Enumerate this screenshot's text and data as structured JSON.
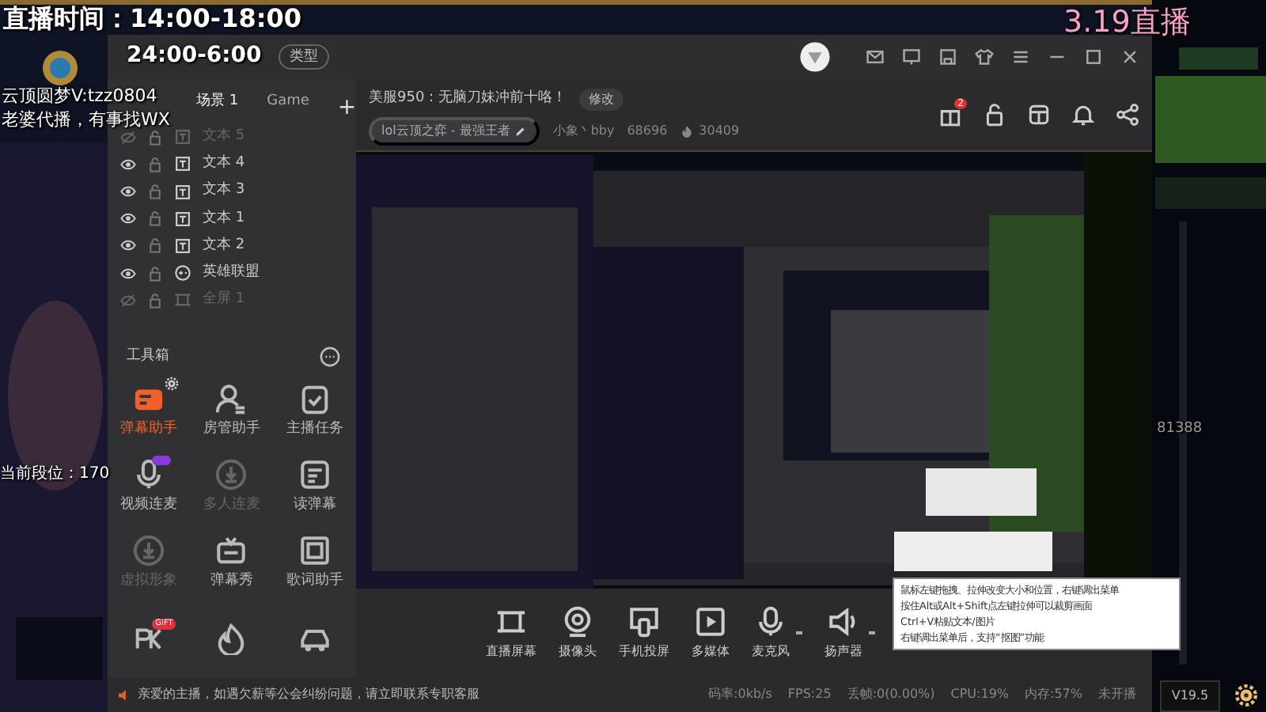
{
  "overlay": {
    "live_time": "直播时间：14:00-18:00",
    "night_time": "24:00-6:00",
    "contact_1": "云顶圆梦V:tzz0804",
    "contact_2": "老婆代播，有事找WX",
    "rank": "当前段位：170",
    "date_live": "3.19直播",
    "side_number": "81388"
  },
  "window": {
    "type_button": "类型",
    "title_icons": [
      {
        "kind": "mail"
      },
      {
        "kind": "monitor"
      },
      {
        "kind": "save"
      },
      {
        "kind": "shirt"
      },
      {
        "kind": "menu"
      },
      {
        "kind": "minimize"
      },
      {
        "kind": "maximize"
      },
      {
        "kind": "close"
      }
    ]
  },
  "scene_tabs": [
    {
      "label": "场景 1",
      "selected": true
    },
    {
      "label": "Game",
      "selected": false
    }
  ],
  "add_scene": "+",
  "layers": [
    {
      "name": "文本 5",
      "kind": "text",
      "visible": false
    },
    {
      "name": "文本 4",
      "kind": "text",
      "visible": true
    },
    {
      "name": "文本 3",
      "kind": "text",
      "visible": true
    },
    {
      "name": "文本 1",
      "kind": "text",
      "visible": true
    },
    {
      "name": "文本 2",
      "kind": "text",
      "visible": true
    },
    {
      "name": "英雄联盟",
      "kind": "game",
      "visible": true
    },
    {
      "name": "全屏 1",
      "kind": "screen",
      "visible": false
    }
  ],
  "toolbox": {
    "title": "工具箱",
    "tools": [
      {
        "label": "弹幕助手",
        "kind": "danmu",
        "selected": true,
        "disabled": false
      },
      {
        "label": "房管助手",
        "kind": "admin",
        "selected": false,
        "disabled": false
      },
      {
        "label": "主播任务",
        "kind": "task",
        "selected": false,
        "disabled": false
      },
      {
        "label": "视频连麦",
        "kind": "mic",
        "selected": false,
        "disabled": false,
        "tag": true
      },
      {
        "label": "多人连麦",
        "kind": "download",
        "selected": false,
        "disabled": true
      },
      {
        "label": "读弹幕",
        "kind": "read",
        "selected": false,
        "disabled": false
      },
      {
        "label": "虚拟形象",
        "kind": "download",
        "selected": false,
        "disabled": true
      },
      {
        "label": "弹幕秀",
        "kind": "tv",
        "selected": false,
        "disabled": false
      },
      {
        "label": "歌词助手",
        "kind": "lyrics",
        "selected": false,
        "disabled": false
      },
      {
        "kind": "pk",
        "selected": false,
        "disabled": false,
        "badge": "GIFT"
      },
      {
        "kind": "fire",
        "selected": false,
        "disabled": false
      },
      {
        "kind": "car",
        "selected": false,
        "disabled": false
      }
    ]
  },
  "stream": {
    "title": "美服950：无脑刀妹冲前十咯！",
    "edit": "修改",
    "category": "lol云顶之弈 - 最强王者",
    "user": "小象丶bby",
    "room": "68696",
    "heat": "30409",
    "actions": [
      {
        "kind": "gift",
        "badge": "2"
      },
      {
        "kind": "lock"
      },
      {
        "kind": "layout"
      },
      {
        "kind": "bell"
      },
      {
        "kind": "share"
      }
    ]
  },
  "preview": {
    "kind": "picture"
  },
  "tooltip": [
    "鼠标左键拖拽、拉伸改变大小和位置，右键调出菜单",
    "按住Alt或Alt+Shift点左键拉伸可以裁剪画面",
    "Ctrl+V粘贴文本/图片",
    "右键调出菜单后，支持“抠图”功能"
  ],
  "sources": [
    {
      "label": "直播屏幕",
      "kind": "screen",
      "menu": false
    },
    {
      "label": "摄像头",
      "kind": "camera",
      "menu": false
    },
    {
      "label": "手机投屏",
      "kind": "phone",
      "menu": false
    },
    {
      "label": "多媒体",
      "kind": "media",
      "menu": false
    },
    {
      "label": "麦克风",
      "kind": "mic",
      "menu": true
    },
    {
      "label": "扬声器",
      "kind": "speaker",
      "menu": true
    }
  ],
  "notice": "亲爱的主播，如遇欠薪等公会纠纷问题，请立即联系专职客服",
  "status": [
    "码率:0kb/s",
    "FPS:25",
    "丢帧:0(0.00%)",
    "CPU:19%",
    "内存:57%",
    "未开播"
  ],
  "version": "V19.5"
}
